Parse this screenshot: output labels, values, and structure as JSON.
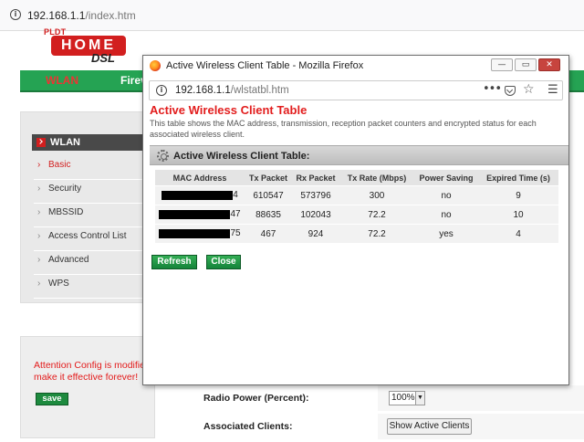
{
  "background": {
    "address_bar": {
      "host": "192.168.1.1",
      "path": "/index.htm"
    },
    "logo": {
      "brand_top": "PLDT",
      "brand_main": "HOME",
      "brand_sub": "DSL"
    },
    "nav": {
      "active_tab": "WLAN",
      "next_tab": "Firev"
    },
    "sidebar": {
      "heading": "WLAN",
      "items": [
        {
          "label": "Basic",
          "active": true
        },
        {
          "label": "Security",
          "active": false
        },
        {
          "label": "MBSSID",
          "active": false
        },
        {
          "label": "Access Control List",
          "active": false
        },
        {
          "label": "Advanced",
          "active": false
        },
        {
          "label": "WPS",
          "active": false
        }
      ]
    },
    "attention": {
      "line1": "Attention Config is modified",
      "line2": "make it effective forever!",
      "save_label": "save"
    },
    "settings": {
      "radio_power_label": "Radio Power (Percent):",
      "radio_power_value": "100%",
      "associated_clients_label": "Associated Clients:",
      "show_clients_button": "Show Active Clients"
    }
  },
  "popup": {
    "window_title": "Active Wireless Client Table - Mozilla Firefox",
    "address_bar": {
      "host": "192.168.1.1",
      "path": "/wlstatbl.htm"
    },
    "page_title": "Active Wireless Client Table",
    "description": "This table shows the MAC address, transmission, reception packet counters and encrypted status for each associated wireless client.",
    "panel_title": "Active Wireless Client Table:",
    "table": {
      "headers": [
        "MAC Address",
        "Tx Packet",
        "Rx Packet",
        "Tx Rate (Mbps)",
        "Power Saving",
        "Expired Time (s)"
      ],
      "rows": [
        {
          "mac_visible": "4",
          "tx": "610547",
          "rx": "573796",
          "rate": "300",
          "power_saving": "no",
          "expired": "9"
        },
        {
          "mac_visible": "47",
          "tx": "88635",
          "rx": "102043",
          "rate": "72.2",
          "power_saving": "no",
          "expired": "10"
        },
        {
          "mac_visible": "75",
          "tx": "467",
          "rx": "924",
          "rate": "72.2",
          "power_saving": "yes",
          "expired": "4"
        }
      ]
    },
    "buttons": {
      "refresh": "Refresh",
      "close": "Close"
    },
    "window_controls": {
      "minimize": "—",
      "restore": "▭",
      "close": "✕"
    }
  }
}
